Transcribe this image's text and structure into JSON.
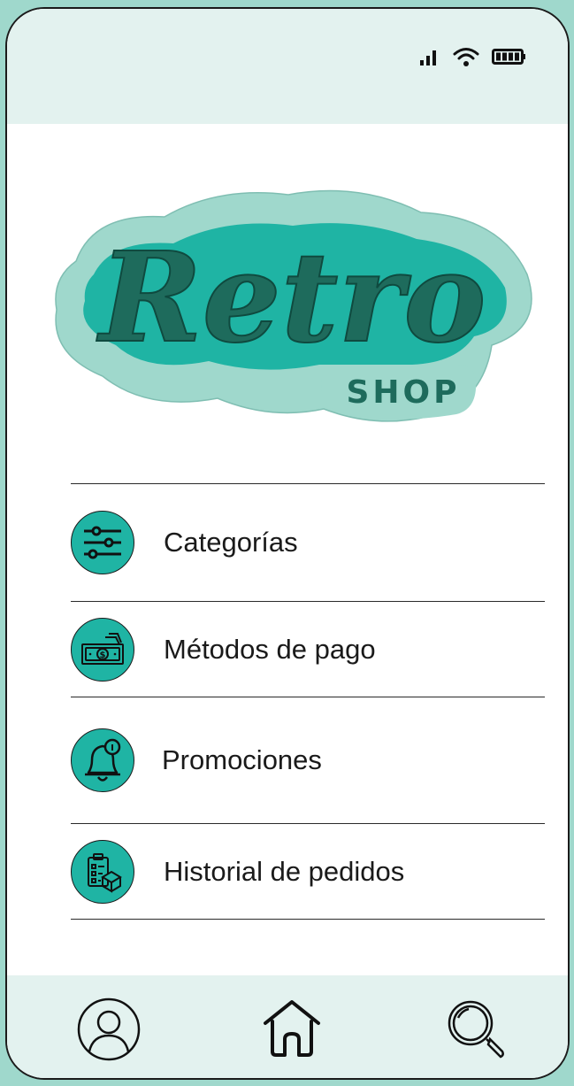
{
  "status_bar": {
    "signal_icon": "signal-icon",
    "wifi_icon": "wifi-icon",
    "battery_icon": "battery-icon"
  },
  "logo": {
    "title": "Retro",
    "subtitle": "SHOP",
    "colors": {
      "outer": "#9fd8cc",
      "middle": "#1fb4a4",
      "text": "#1e6b5c"
    }
  },
  "menu": {
    "items": [
      {
        "label": "Categorías",
        "icon": "sliders-icon"
      },
      {
        "label": "Métodos de pago",
        "icon": "money-icon"
      },
      {
        "label": "Promociones",
        "icon": "bell-icon"
      },
      {
        "label": "Historial de pedidos",
        "icon": "order-history-icon"
      }
    ]
  },
  "bottom_nav": {
    "items": [
      {
        "icon": "user-icon"
      },
      {
        "icon": "home-icon"
      },
      {
        "icon": "search-icon"
      }
    ]
  },
  "colors": {
    "accent": "#1fb4a4",
    "bar_background": "#e3f2ef",
    "frame_background": "#9fd8cc"
  }
}
